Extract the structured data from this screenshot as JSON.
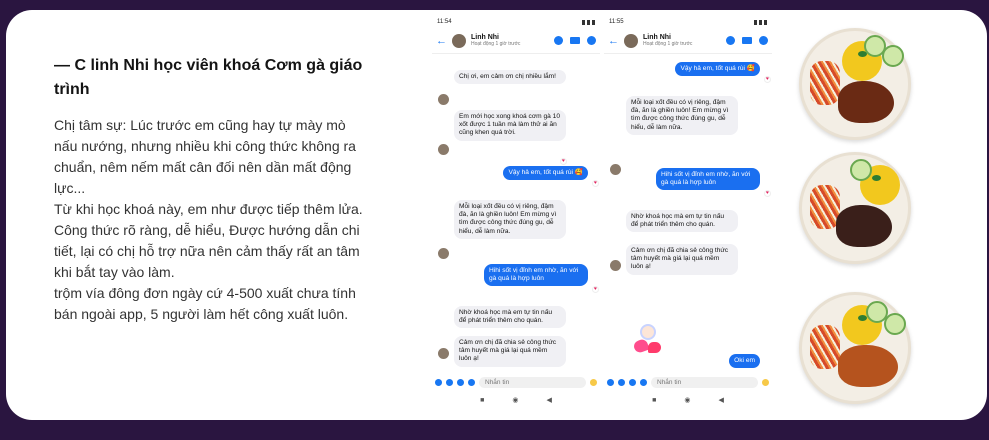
{
  "testimonial": {
    "title": "— C linh Nhi  học viên khoá Cơm gà giáo trình",
    "body_lines": [
      "Chị tâm sự: Lúc trước em cũng hay tự mày mò nấu nướng, nhưng nhiều khi công thức không ra chuẩn, nêm nếm mất cân đối nên dần mất động lực...",
      "Từ khi học khoá này, em như được tiếp thêm lửa. Công thức rõ ràng, dễ hiểu, Được hướng dẫn chi tiết, lại có chị hỗ trợ nữa nên cảm thấy rất an tâm khi bắt tay vào làm.",
      "trộm vía đông đơn ngày cứ 4-500 xuất chưa tính bán ngoài app, 5 người làm hết công xuất luôn."
    ]
  },
  "phones": [
    {
      "time": "11:54",
      "contact": "Linh Nhi",
      "status": "Hoạt động 1 giờ trước",
      "messages": [
        {
          "dir": "in",
          "text": "Chị ơi, em cảm ơn chị nhiều lắm!"
        },
        {
          "dir": "in",
          "text": "Em mới học xong khoá cơm gà 10 xốt được 1 tuần mà làm thử ai ăn cũng khen quá trời."
        },
        {
          "dir": "out",
          "text": "Vậy hả em, tốt quá rùi 🥰"
        },
        {
          "dir": "in",
          "text": "Mỗi loại xốt đều có vị riêng, đậm đà, ăn là ghiền luôn! Em mừng vì tìm được công thức đúng gu, dễ hiểu, dễ làm nữa."
        },
        {
          "dir": "out",
          "text": "Hihi sốt vị đỉnh em nhờ, ăn với gà quá là hợp luôn"
        },
        {
          "dir": "in",
          "text": "Nhờ khoá học mà em tự tin nấu để phát triển thêm cho quán."
        },
        {
          "dir": "in",
          "text": "Cảm ơn chị đã chia sẻ công thức tâm huyết mà giá lại quá mềm luôn ạ!"
        }
      ],
      "composer_placeholder": "Nhắn tin"
    },
    {
      "time": "11:55",
      "contact": "Linh Nhi",
      "status": "Hoạt động 1 giờ trước",
      "messages": [
        {
          "dir": "out",
          "text": "Vậy hả em, tốt quá rùi 🥰"
        },
        {
          "dir": "in",
          "text": "Mỗi loại xốt đều có vị riêng, đậm đà, ăn là ghiền luôn! Em mừng vì tìm được công thức đúng gu, dễ hiểu, dễ làm nữa."
        },
        {
          "dir": "out",
          "text": "Hihi sốt vị đỉnh em nhờ, ăn với gà quá là hợp luôn"
        },
        {
          "dir": "in",
          "text": "Nhờ khoá học mà em tự tin nấu để phát triển thêm cho quán."
        },
        {
          "dir": "in",
          "text": "Cảm ơn chị đã chia sẻ công thức tâm huyết mà giá lại quá mềm luôn ạ!"
        },
        {
          "dir": "out",
          "text": "Oki em"
        }
      ],
      "composer_placeholder": "Nhắn tin"
    }
  ],
  "colors": {
    "background": "#2a1540",
    "card": "#ffffff",
    "messenger_blue": "#1a6ff0"
  },
  "icons": [
    "back-arrow-icon",
    "phone-call-icon",
    "video-call-icon",
    "info-icon",
    "plus-icon",
    "camera-icon",
    "image-icon",
    "mic-icon",
    "emoji-icon",
    "heart-reaction-icon",
    "nav-square-icon",
    "nav-circle-icon",
    "nav-back-icon"
  ]
}
